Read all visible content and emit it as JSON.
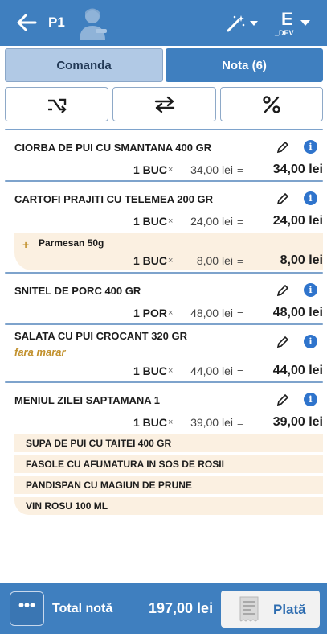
{
  "header": {
    "title": "P1",
    "back_icon": "back-arrow-icon",
    "avatar_icon": "waiter-avatar-icon",
    "magic_icon": "magic-wand-icon",
    "user_letter": "E",
    "user_sub": "_DEV"
  },
  "tabs": [
    {
      "label": "Comanda",
      "active": false
    },
    {
      "label": "Nota (6)",
      "active": true
    }
  ],
  "actions": [
    {
      "icon": "split-arrows-icon"
    },
    {
      "icon": "transfer-arrows-icon"
    },
    {
      "icon": "percent-icon"
    }
  ],
  "items": [
    {
      "name": "CIORBA DE PUI CU SMANTANA 400 GR",
      "qty": "1 BUC",
      "unit_price": "34,00 lei",
      "total": "34,00 lei"
    },
    {
      "name": "CARTOFI PRAJITI CU TELEMEA 200 GR",
      "qty": "1 BUC",
      "unit_price": "24,00 lei",
      "total": "24,00 lei",
      "modifier": {
        "plus": "+",
        "name": "Parmesan 50g",
        "qty": "1 BUC",
        "unit_price": "8,00 lei",
        "total": "8,00 lei"
      }
    },
    {
      "name": "SNITEL DE PORC 400 GR",
      "qty": "1 POR",
      "unit_price": "48,00 lei",
      "total": "48,00 lei"
    },
    {
      "name": "SALATA CU PUI CROCANT 320 GR",
      "note": "fara marar",
      "qty": "1 BUC",
      "unit_price": "44,00 lei",
      "total": "44,00 lei"
    },
    {
      "name": "MENIUL ZILEI SAPTAMANA 1",
      "qty": "1 BUC",
      "unit_price": "39,00 lei",
      "total": "39,00 lei",
      "components": [
        "SUPA DE PUI CU TAITEI 400 GR",
        "FASOLE CU AFUMATURA IN SOS DE ROSII",
        "PANDISPAN CU MAGIUN DE PRUNE",
        "VIN ROSU 100 ML"
      ]
    }
  ],
  "symbols": {
    "times": "×",
    "equals": "="
  },
  "footer": {
    "more_label": "•••",
    "total_label": "Total notă",
    "total_value": "197,00 lei",
    "pay_label": "Plată",
    "pay_icon": "receipt-icon"
  },
  "colors": {
    "primary": "#3f7fbf",
    "modifier_bg": "#fbf0e1",
    "info": "#2f74cc",
    "note": "#c2912d"
  }
}
